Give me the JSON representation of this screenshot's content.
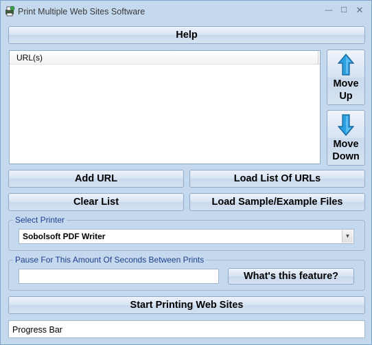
{
  "window": {
    "title": "Print Multiple Web Sites Software",
    "minimize_label": "—",
    "maximize_label": "☐",
    "close_label": "✕"
  },
  "buttons": {
    "help": "Help",
    "move_up_line1": "Move",
    "move_up_line2": "Up",
    "move_down_line1": "Move",
    "move_down_line2": "Down",
    "add_url": "Add URL",
    "load_list": "Load List Of URLs",
    "clear_list": "Clear List",
    "load_sample": "Load Sample/Example Files",
    "whats_this": "What's this feature?",
    "start_printing": "Start Printing Web Sites"
  },
  "url_list": {
    "column_header": "URL(s)",
    "items": []
  },
  "printer": {
    "group_label": "Select Printer",
    "selected": "Sobolsoft PDF Writer"
  },
  "pause": {
    "group_label": "Pause For This Amount Of Seconds Between Prints",
    "value": ""
  },
  "progress": {
    "label": "Progress Bar"
  },
  "colors": {
    "window_bg": "#c4d8ee",
    "group_label": "#1f3f8c",
    "arrow_blue": "#2b9fe0"
  },
  "icons": {
    "app": "printer-globe-icon",
    "move_up": "arrow-up-icon",
    "move_down": "arrow-down-icon",
    "dropdown": "chevron-down-icon"
  }
}
